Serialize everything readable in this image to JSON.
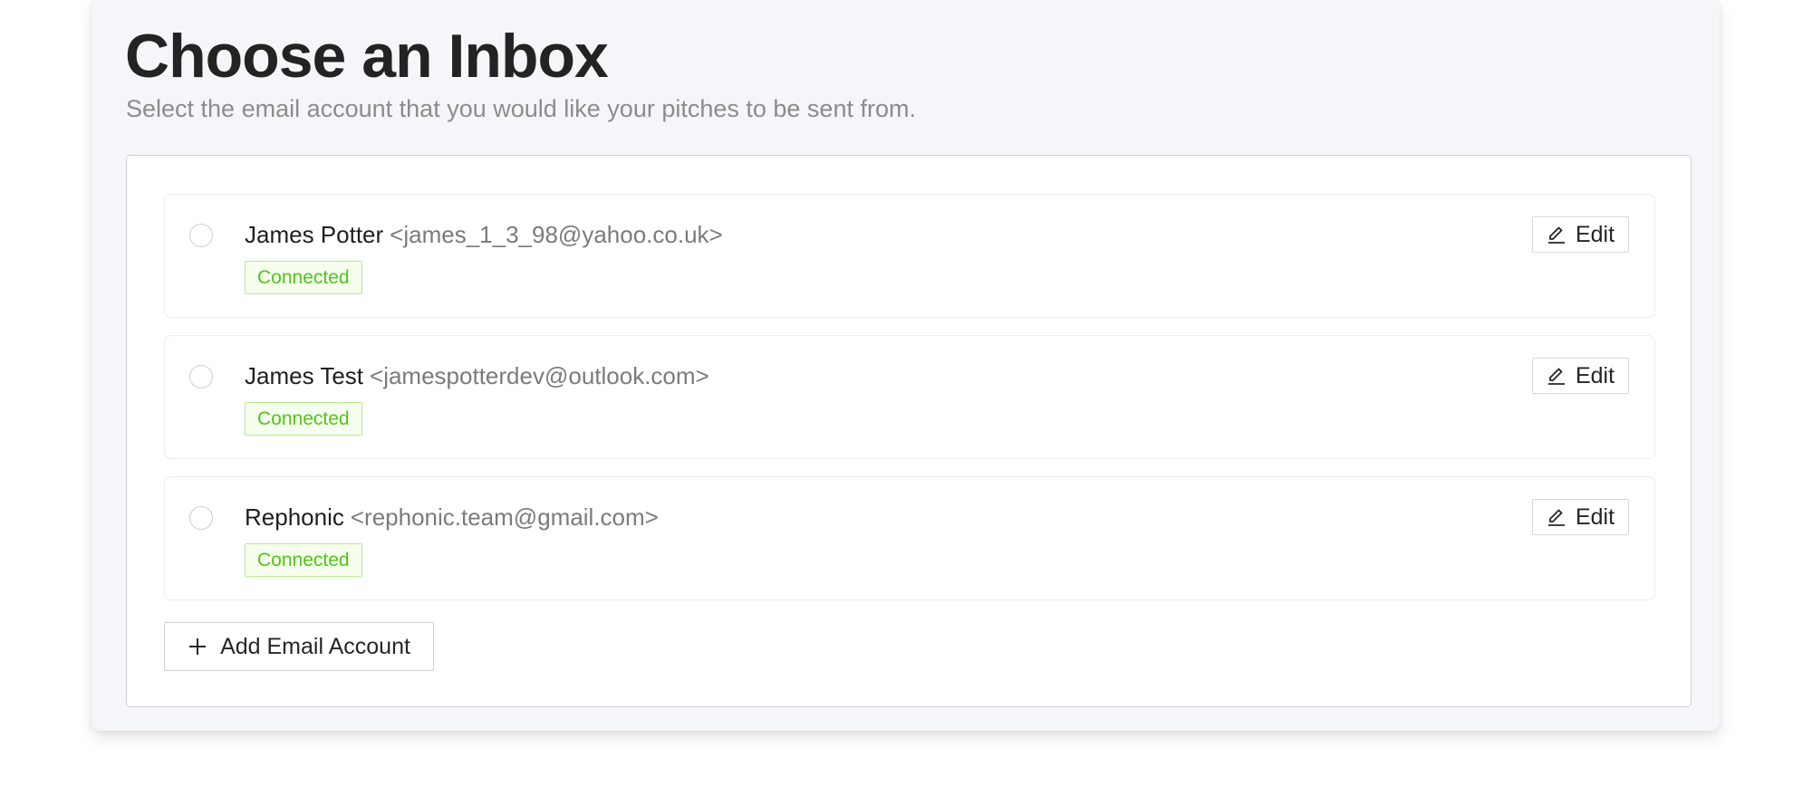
{
  "header": {
    "title": "Choose an Inbox",
    "subtitle": "Select the email account that you would like your pitches to be sent from."
  },
  "accounts": [
    {
      "name": "James Potter",
      "email": "<james_1_3_98@yahoo.co.uk>",
      "status": "Connected",
      "edit_label": "Edit",
      "selected": false
    },
    {
      "name": "James Test",
      "email": "<jamespotterdev@outlook.com>",
      "status": "Connected",
      "edit_label": "Edit",
      "selected": false
    },
    {
      "name": "Rephonic",
      "email": "<rephonic.team@gmail.com>",
      "status": "Connected",
      "edit_label": "Edit",
      "selected": false
    }
  ],
  "add_account": {
    "label": "Add Email Account"
  },
  "icons": {
    "edit": "pencil-icon",
    "add": "plus-icon"
  },
  "colors": {
    "connected_text": "#52c41a",
    "connected_border": "#b7eb8f",
    "connected_bg": "#f6ffed",
    "title": "#232323",
    "subtitle": "#8c8c8c"
  }
}
